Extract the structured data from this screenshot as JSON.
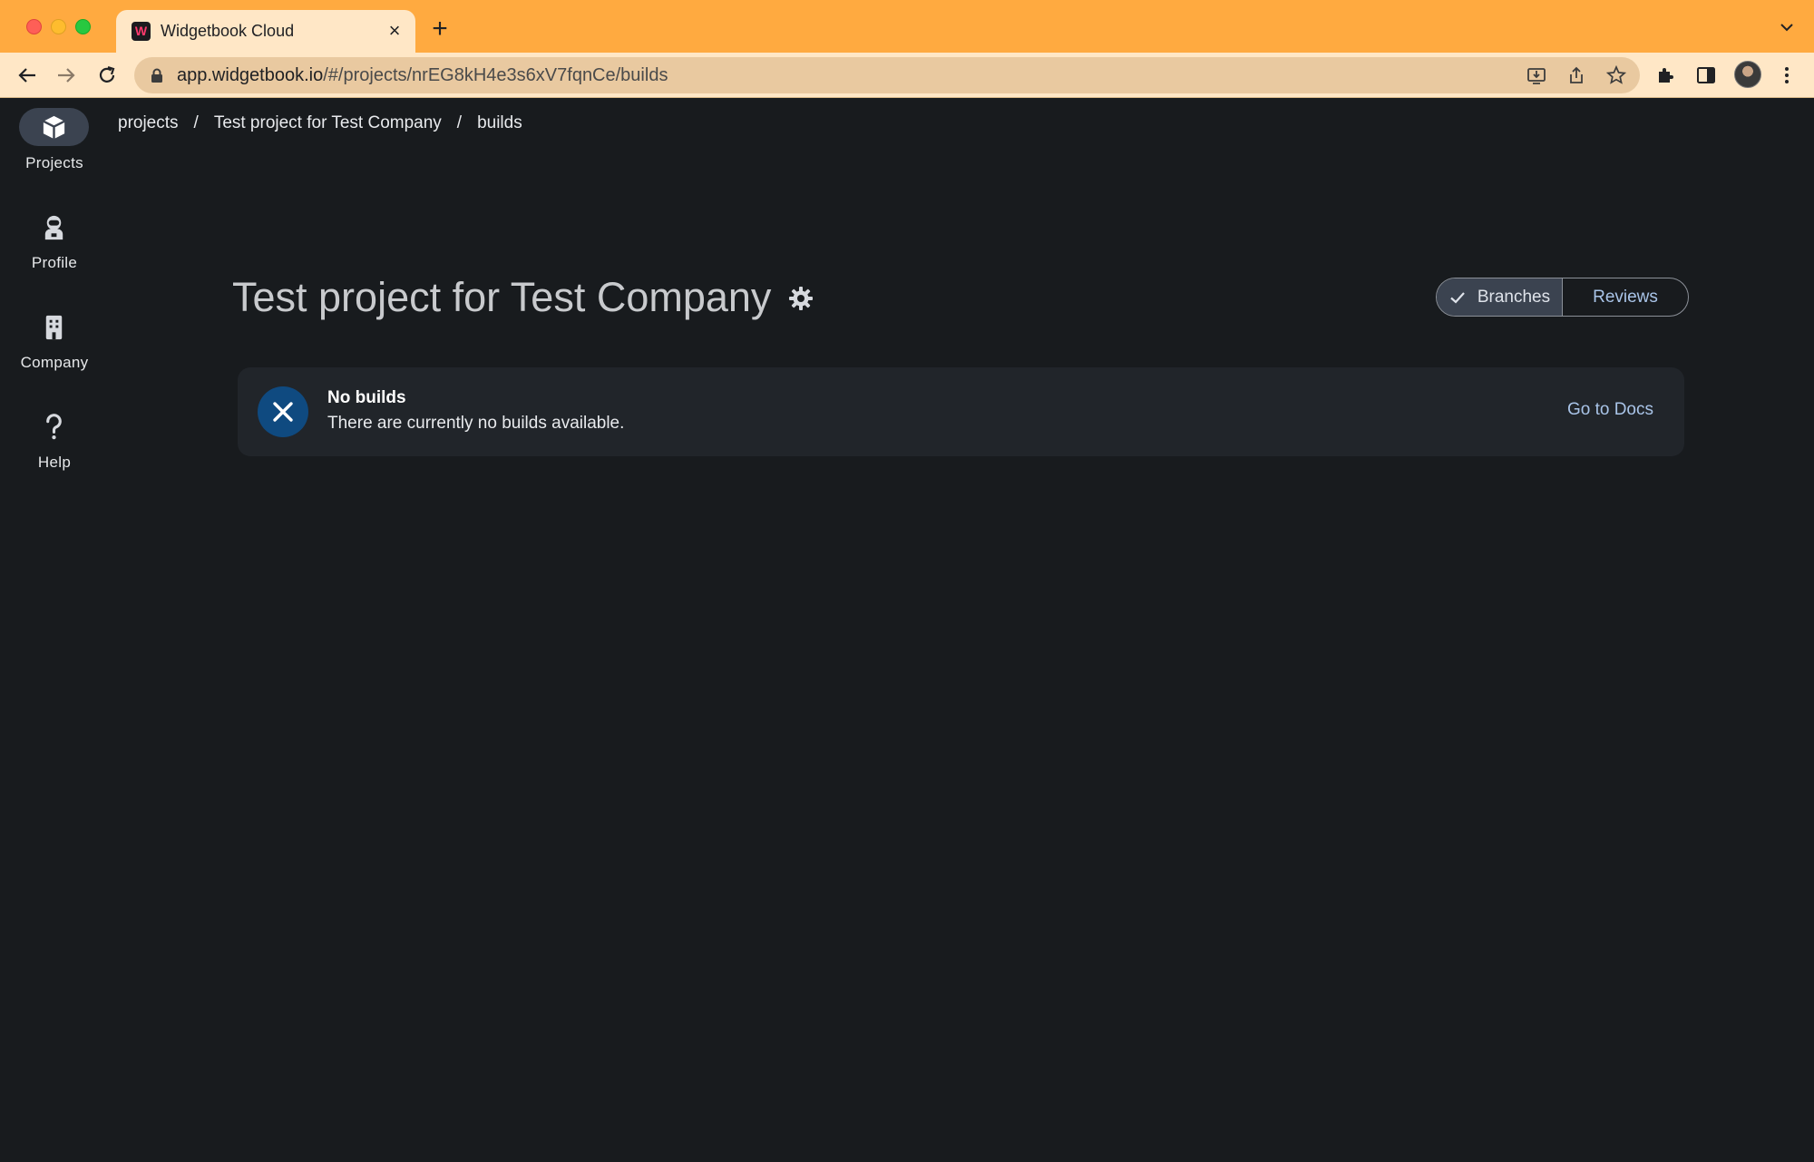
{
  "browser": {
    "tab_title": "Widgetbook Cloud",
    "favicon_letter": "W",
    "url_host": "app.widgetbook.io",
    "url_path": "/#/projects/nrEG8kH4e3s6xV7fqnCe/builds",
    "chrome_color": "#ffaa40"
  },
  "sidebar": {
    "items": [
      {
        "label": "Projects",
        "icon": "cube-icon",
        "active": true
      },
      {
        "label": "Profile",
        "icon": "astronaut-icon",
        "active": false
      },
      {
        "label": "Company",
        "icon": "building-icon",
        "active": false
      },
      {
        "label": "Help",
        "icon": "question-icon",
        "active": false
      }
    ]
  },
  "breadcrumb": {
    "items": [
      "projects",
      "Test project for Test Company",
      "builds"
    ],
    "separator": "/"
  },
  "page": {
    "title": "Test project for Test Company"
  },
  "view_toggle": {
    "options": [
      {
        "label": "Branches",
        "selected": true
      },
      {
        "label": "Reviews",
        "selected": false
      }
    ]
  },
  "empty_state": {
    "title": "No builds",
    "message": "There are currently no builds available.",
    "link_label": "Go to Docs",
    "icon": "close-icon"
  },
  "colors": {
    "background": "#181b1e",
    "card": "#21252a",
    "accent_link": "#a9c4e8",
    "icon_circle": "#0f4a80",
    "active_nav": "#3b4350"
  }
}
